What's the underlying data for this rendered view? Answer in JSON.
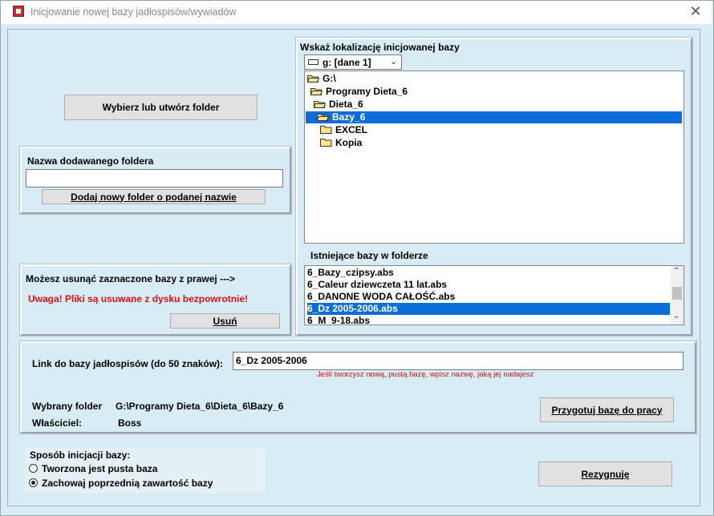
{
  "window": {
    "title": "Inicjowanie nowej bazy jadłospisów/wywiadów",
    "close_glyph": "✕"
  },
  "left": {
    "choose_folder_button": "Wybierz lub utwórz  folder",
    "new_folder": {
      "label": "Nazwa dodawanego foldera",
      "value": "",
      "add_button": "Dodaj nowy folder o podanej nazwie"
    },
    "delete": {
      "info": "Możesz usunąć zaznaczone bazy z prawej --->",
      "warning": "Uwaga! Pliki są usuwane z dysku bezpowrotnie!",
      "button": "Usuń"
    }
  },
  "right": {
    "location_label": "Wskaż lokalizację inicjowanej bazy",
    "drive_select": "g: [dane 1]",
    "tree": [
      {
        "label": "G:\\",
        "selected": false
      },
      {
        "label": "Programy Dieta_6",
        "selected": false
      },
      {
        "label": "Dieta_6",
        "selected": false
      },
      {
        "label": "Bazy_6",
        "selected": true
      },
      {
        "label": "EXCEL",
        "selected": false
      },
      {
        "label": "Kopia",
        "selected": false
      }
    ],
    "existing_label": "Istniejące bazy w folderze",
    "existing": [
      {
        "label": "6_Bazy_czipsy.abs",
        "selected": false
      },
      {
        "label": "6_Caleur dziewczeta 11 lat.abs",
        "selected": false
      },
      {
        "label": "6_DANONE WODA CAŁOŚĆ.abs",
        "selected": false
      },
      {
        "label": "6_Dz 2005-2006.abs",
        "selected": true
      },
      {
        "label": "6_M_9-18.abs",
        "selected": false
      }
    ]
  },
  "link": {
    "label": "Link do bazy jadłospisów (do 50 znaków):",
    "value": "6_Dz 2005-2006",
    "hint": "Jeśli tworzysz nową, pustą bazę, wpisz nazwę, jaką jej nadajesz"
  },
  "info": {
    "folder_label": "Wybrany folder",
    "folder_value": "G:\\Programy Dieta_6\\Dieta_6\\Bazy_6",
    "owner_label": "Właściciel:",
    "owner_value": "Boss",
    "prepare_button": "Przygotuj bazę do pracy"
  },
  "init_mode": {
    "label": "Sposób inicjacji bazy:",
    "options": [
      {
        "label": "Tworzona jest pusta baza",
        "checked": false
      },
      {
        "label": "Zachowaj poprzednią zawartość bazy",
        "checked": true
      }
    ]
  },
  "cancel_button": "Rezygnuję",
  "colors": {
    "selection": "#0a6ed6",
    "warning": "#e01010",
    "background": "#d8ecf5"
  }
}
